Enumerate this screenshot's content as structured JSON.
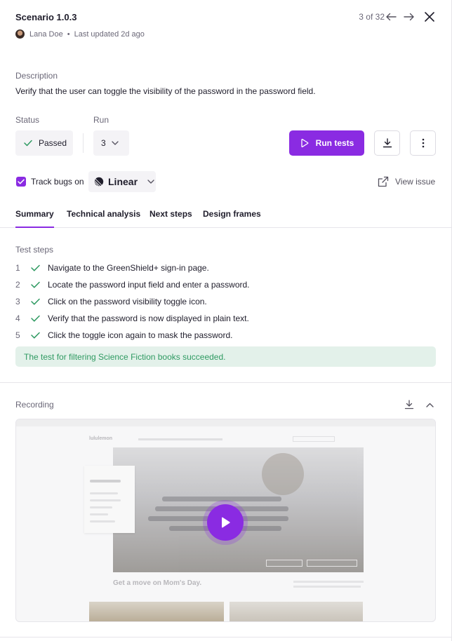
{
  "header": {
    "title": "Scenario 1.0.3",
    "author": "Lana Doe",
    "separator": "•",
    "updated": "Last updated 2d ago",
    "pager": "3 of 32"
  },
  "description": {
    "label": "Description",
    "text": "Verify that the user can toggle the visibility of the password in the password field."
  },
  "status": {
    "label": "Status",
    "value": "Passed"
  },
  "run": {
    "label": "Run",
    "value": "3"
  },
  "actions": {
    "run_tests": "Run tests"
  },
  "tracking": {
    "label": "Track bugs on",
    "tool": "Linear",
    "checked": true,
    "view_issue": "View issue"
  },
  "tabs": [
    {
      "label": "Summary",
      "active": true
    },
    {
      "label": "Technical analysis"
    },
    {
      "label": "Next steps"
    },
    {
      "label": "Design frames"
    }
  ],
  "test_steps": {
    "label": "Test steps",
    "items": [
      {
        "num": "1",
        "text": "Navigate to the GreenShield+ sign-in page."
      },
      {
        "num": "2",
        "text": "Locate the password input field and enter a password."
      },
      {
        "num": "3",
        "text": "Click on the password visibility toggle icon."
      },
      {
        "num": "4",
        "text": "Verify that the password is now displayed in plain text."
      },
      {
        "num": "5",
        "text": "Click the toggle icon again to mask the password."
      }
    ]
  },
  "result": "The test for filtering Science Fiction books succeeded.",
  "recording": {
    "label": "Recording",
    "preview": {
      "brand": "lululemon",
      "heading": "Get a move on Mom's Day."
    }
  },
  "colors": {
    "accent": "#8a2be2",
    "success_bg": "#e3f1ea",
    "success_text": "#2f9a62"
  }
}
